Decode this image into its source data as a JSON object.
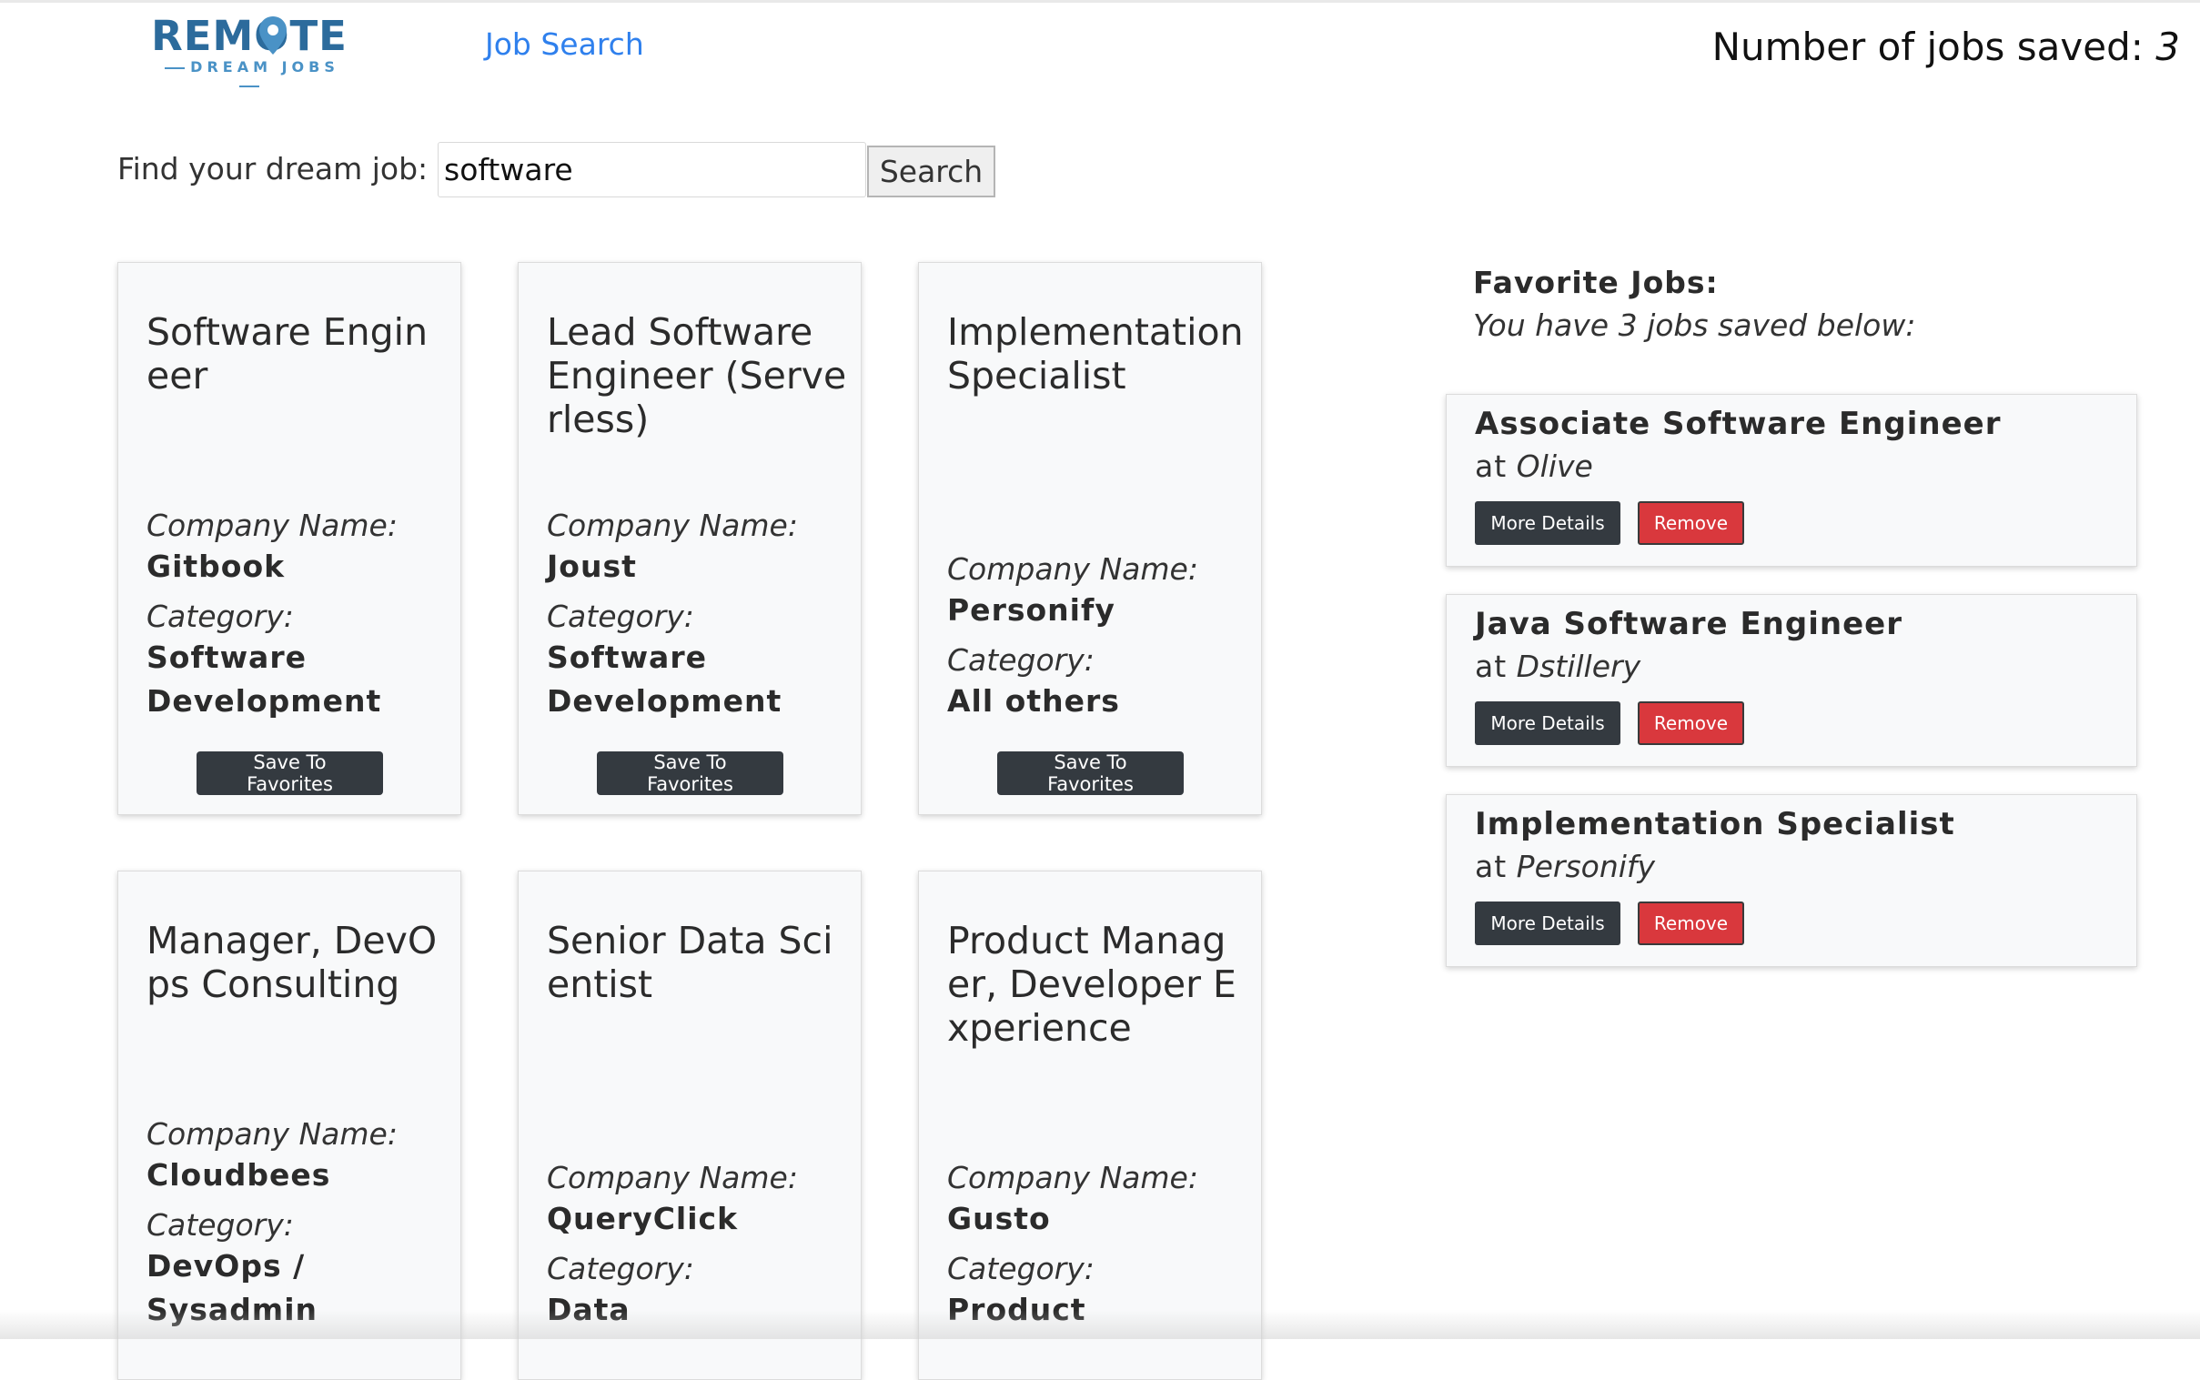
{
  "header": {
    "logo": {
      "main": "REMOTE",
      "sub": "DREAM JOBS"
    },
    "nav_link": "Job Search",
    "saved_label": "Number of jobs saved:",
    "saved_count": "3"
  },
  "search": {
    "label": "Find your dream job:",
    "value": "software",
    "placeholder": "",
    "button_label": "Search"
  },
  "labels": {
    "company": "Company Name:",
    "category": "Category:",
    "save_button": "Save To Favorites"
  },
  "jobs": [
    {
      "title": "Software Engineer",
      "company": "Gitbook",
      "category": "Software Development"
    },
    {
      "title": "Lead Software Engineer (Serverless)",
      "company": "Joust",
      "category": "Software Development"
    },
    {
      "title": "Implementation Specialist",
      "company": "Personify",
      "category": "All others"
    },
    {
      "title": "Manager, DevOps Consulting",
      "company": "Cloudbees",
      "category": "DevOps / Sysadmin"
    },
    {
      "title": "Senior Data Scientist",
      "company": "QueryClick",
      "category": "Data"
    },
    {
      "title": "Product Manager, Developer Experience",
      "company": "Gusto",
      "category": "Product"
    }
  ],
  "favorites": {
    "heading": "Favorite Jobs:",
    "subheading": "You have 3 jobs saved below:",
    "at_label": "at",
    "details_button": "More Details",
    "remove_button": "Remove",
    "items": [
      {
        "title": "Associate Software Engineer",
        "company": "Olive"
      },
      {
        "title": "Java Software Engineer",
        "company": "Dstillery"
      },
      {
        "title": "Implementation Specialist",
        "company": "Personify"
      }
    ]
  },
  "colors": {
    "brand": "#2c6b9c",
    "link": "#2f80ed",
    "dark_button": "#343a40",
    "danger_button": "#d9383d",
    "card_bg": "#f8f9fa"
  }
}
